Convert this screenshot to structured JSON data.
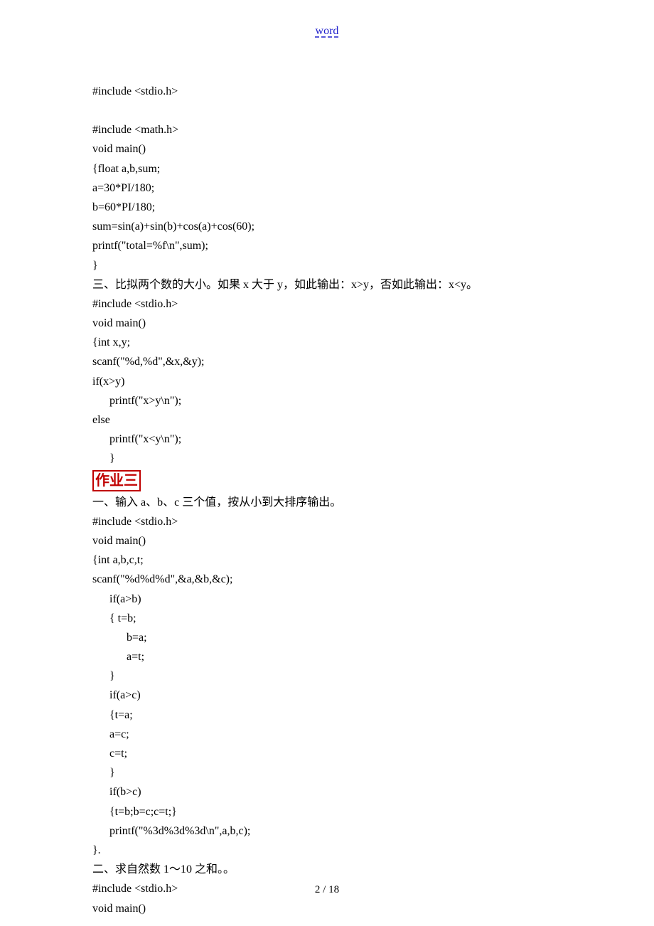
{
  "header_link": "word",
  "footer": "2  / 18",
  "lines": [
    {
      "text": "#include <stdio.h>",
      "cls": ""
    },
    {
      "text": "",
      "cls": "empty"
    },
    {
      "text": "#include <math.h>",
      "cls": ""
    },
    {
      "text": "void main()",
      "cls": ""
    },
    {
      "text": "{float a,b,sum;",
      "cls": ""
    },
    {
      "text": "a=30*PI/180;",
      "cls": ""
    },
    {
      "text": "b=60*PI/180;",
      "cls": ""
    },
    {
      "text": "sum=sin(a)+sin(b)+cos(a)+cos(60);",
      "cls": ""
    },
    {
      "text": "printf(\"total=%f\\n\",sum);",
      "cls": ""
    },
    {
      "text": "}",
      "cls": ""
    },
    {
      "text": "三、比拟两个数的大小。如果 x 大于 y，如此输出：x>y，否如此输出：x<y。",
      "cls": ""
    },
    {
      "text": "#include <stdio.h>",
      "cls": ""
    },
    {
      "text": "void main()",
      "cls": ""
    },
    {
      "text": "{int x,y;",
      "cls": ""
    },
    {
      "text": "scanf(\"%d,%d\",&x,&y);",
      "cls": ""
    },
    {
      "text": "if(x>y)",
      "cls": ""
    },
    {
      "text": "printf(\"x>y\\n\");",
      "cls": "indent1"
    },
    {
      "text": "else",
      "cls": ""
    },
    {
      "text": "printf(\"x<y\\n\");",
      "cls": "indent1"
    },
    {
      "text": "}",
      "cls": "indent1"
    },
    {
      "text": "作业三",
      "cls": "boxed-wrap"
    },
    {
      "text": "一、输入 a、b、c 三个值，按从小到大排序输出。",
      "cls": ""
    },
    {
      "text": "#include <stdio.h>",
      "cls": ""
    },
    {
      "text": "void main()",
      "cls": ""
    },
    {
      "text": "{int a,b,c,t;",
      "cls": ""
    },
    {
      "text": "scanf(\"%d%d%d\",&a,&b,&c);",
      "cls": ""
    },
    {
      "text": "if(a>b)",
      "cls": "indent1"
    },
    {
      "text": "{ t=b;",
      "cls": "indent1"
    },
    {
      "text": "b=a;",
      "cls": "indent2"
    },
    {
      "text": "a=t;",
      "cls": "indent2"
    },
    {
      "text": "}",
      "cls": "indent1"
    },
    {
      "text": "if(a>c)",
      "cls": "indent1"
    },
    {
      "text": "{t=a;",
      "cls": "indent1"
    },
    {
      "text": "a=c;",
      "cls": "indent1"
    },
    {
      "text": "c=t;",
      "cls": "indent1"
    },
    {
      "text": "}",
      "cls": "indent1"
    },
    {
      "text": "if(b>c)",
      "cls": "indent1"
    },
    {
      "text": "{t=b;b=c;c=t;}",
      "cls": "indent1"
    },
    {
      "text": "printf(\"%3d%3d%3d\\n\",a,b,c);",
      "cls": "indent1"
    },
    {
      "text": "}.",
      "cls": ""
    },
    {
      "text": "二、求自然数 1～10 之和。。",
      "cls": ""
    },
    {
      "text": "#include <stdio.h>",
      "cls": ""
    },
    {
      "text": "void main()",
      "cls": ""
    }
  ]
}
